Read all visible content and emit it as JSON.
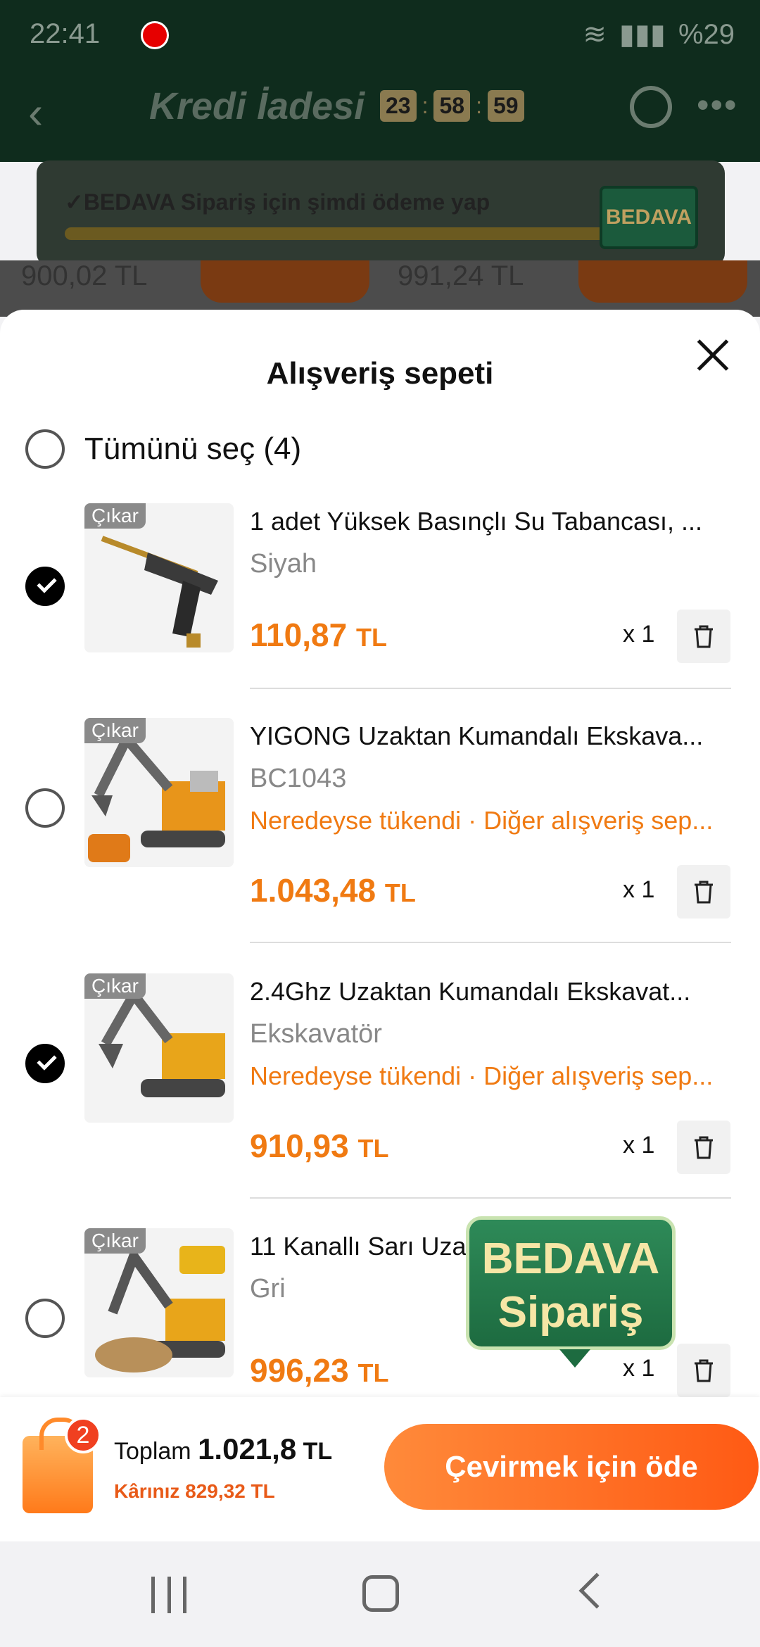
{
  "status_bar": {
    "time": "22:41",
    "battery": "%29"
  },
  "app_bar": {
    "title": "Kredi İadesi",
    "timer_h": "23",
    "timer_m": "58",
    "timer_s": "59",
    "sep": ":"
  },
  "banner": {
    "text": "✓BEDAVA Sipariş için şimdi ödeme yap",
    "button": "BEDAVA"
  },
  "background": {
    "price_left": "900,02 TL",
    "price_right": "991,24 TL"
  },
  "sheet": {
    "title": "Alışveriş sepeti",
    "select_all": "Tümünü seç (4)",
    "remove_label": "Çıkar",
    "items": [
      {
        "name": "1 adet Yüksek Basınçlı Su Tabancası, ...",
        "variant": "Siyah",
        "warning": "",
        "price": "110,87",
        "currency": "TL",
        "qty": "x 1",
        "selected": true
      },
      {
        "name": "YIGONG Uzaktan Kumandalı Ekskava...",
        "variant": "BC1043",
        "warning": "Neredeyse tükendi · Diğer alışveriş sep...",
        "price": "1.043,48",
        "currency": "TL",
        "qty": "x 1",
        "selected": false
      },
      {
        "name": "2.4Ghz Uzaktan Kumandalı Ekskavat...",
        "variant": "Ekskavatör",
        "warning": "Neredeyse tükendi · Diğer alışveriş sep...",
        "price": "910,93",
        "currency": "TL",
        "qty": "x 1",
        "selected": true
      },
      {
        "name": "11 Kanallı Sarı Uza... ...k...",
        "variant": "Gri",
        "warning": "",
        "price": "996,23",
        "currency": "TL",
        "qty": "x 1",
        "selected": false
      }
    ]
  },
  "bedava_popup": {
    "line1": "BEDAVA",
    "line2": "Sipariş"
  },
  "footer": {
    "badge": "2",
    "total_label": "Toplam",
    "total_value": "1.021,8",
    "currency": "TL",
    "profit_label": "Kârınız",
    "profit_value": "829,32 TL",
    "pay_button": "Çevirmek için öde"
  }
}
